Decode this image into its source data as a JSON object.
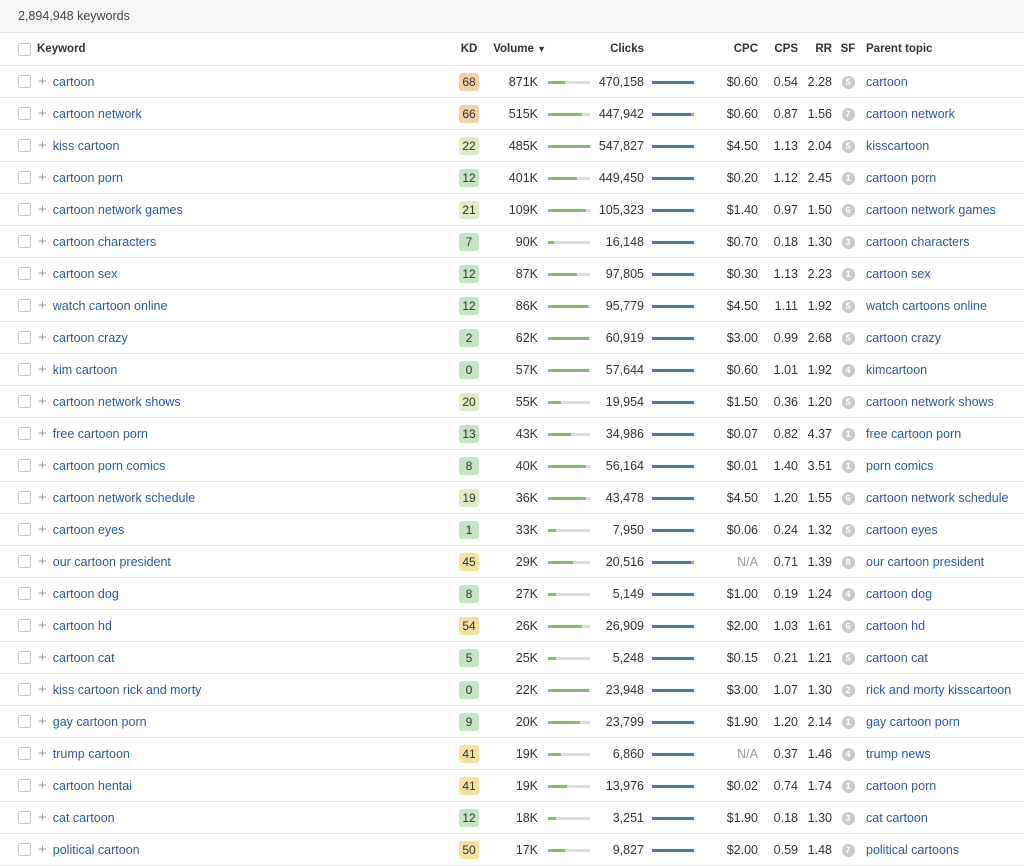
{
  "summary": "2,894,948 keywords",
  "headers": {
    "keyword": "Keyword",
    "kd": "KD",
    "volume": "Volume",
    "clicks": "Clicks",
    "cpc": "CPC",
    "cps": "CPS",
    "rr": "RR",
    "sf": "SF",
    "parent_topic": "Parent topic"
  },
  "sort_indicator": "▼",
  "colors": {
    "link": "#2b59a6",
    "volume_bar": "#7ac36a",
    "clicks_bar": "#4a79b9",
    "clicks_tip": "#e8a23a"
  },
  "rows": [
    {
      "keyword": "cartoon",
      "kd": "68",
      "kd_color": "#f2d2a6",
      "volume": "871K",
      "volume_level": 0.4,
      "clicks": "470,158",
      "tip": false,
      "cpc": "$0.60",
      "cps": "0.54",
      "rr": "2.28",
      "sf": "5",
      "parent": "cartoon"
    },
    {
      "keyword": "cartoon network",
      "kd": "66",
      "kd_color": "#f2d2a6",
      "volume": "515K",
      "volume_level": 0.8,
      "clicks": "447,942",
      "tip": true,
      "cpc": "$0.60",
      "cps": "0.87",
      "rr": "1.56",
      "sf": "7",
      "parent": "cartoon network"
    },
    {
      "keyword": "kiss cartoon",
      "kd": "22",
      "kd_color": "#e0eac4",
      "volume": "485K",
      "volume_level": 1.0,
      "clicks": "547,827",
      "tip": false,
      "cpc": "$4.50",
      "cps": "1.13",
      "rr": "2.04",
      "sf": "5",
      "parent": "kisscartoon"
    },
    {
      "keyword": "cartoon porn",
      "kd": "12",
      "kd_color": "#c7e2c5",
      "volume": "401K",
      "volume_level": 0.7,
      "clicks": "449,450",
      "tip": false,
      "cpc": "$0.20",
      "cps": "1.12",
      "rr": "2.45",
      "sf": "1",
      "parent": "cartoon porn"
    },
    {
      "keyword": "cartoon network games",
      "kd": "21",
      "kd_color": "#e0eac4",
      "volume": "109K",
      "volume_level": 0.9,
      "clicks": "105,323",
      "tip": false,
      "cpc": "$1.40",
      "cps": "0.97",
      "rr": "1.50",
      "sf": "6",
      "parent": "cartoon network games"
    },
    {
      "keyword": "cartoon characters",
      "kd": "7",
      "kd_color": "#c7e2c5",
      "volume": "90K",
      "volume_level": 0.15,
      "clicks": "16,148",
      "tip": false,
      "cpc": "$0.70",
      "cps": "0.18",
      "rr": "1.30",
      "sf": "3",
      "parent": "cartoon characters"
    },
    {
      "keyword": "cartoon sex",
      "kd": "12",
      "kd_color": "#c7e2c5",
      "volume": "87K",
      "volume_level": 0.7,
      "clicks": "97,805",
      "tip": false,
      "cpc": "$0.30",
      "cps": "1.13",
      "rr": "2.23",
      "sf": "1",
      "parent": "cartoon sex"
    },
    {
      "keyword": "watch cartoon online",
      "kd": "12",
      "kd_color": "#c7e2c5",
      "volume": "86K",
      "volume_level": 0.95,
      "clicks": "95,779",
      "tip": false,
      "cpc": "$4.50",
      "cps": "1.11",
      "rr": "1.92",
      "sf": "5",
      "parent": "watch cartoons online"
    },
    {
      "keyword": "cartoon crazy",
      "kd": "2",
      "kd_color": "#c7e2c5",
      "volume": "62K",
      "volume_level": 0.98,
      "clicks": "60,919",
      "tip": false,
      "cpc": "$3.00",
      "cps": "0.99",
      "rr": "2.68",
      "sf": "5",
      "parent": "cartoon crazy"
    },
    {
      "keyword": "kim cartoon",
      "kd": "0",
      "kd_color": "#c7e2c5",
      "volume": "57K",
      "volume_level": 0.98,
      "clicks": "57,644",
      "tip": false,
      "cpc": "$0.60",
      "cps": "1.01",
      "rr": "1.92",
      "sf": "4",
      "parent": "kimcartoon"
    },
    {
      "keyword": "cartoon network shows",
      "kd": "20",
      "kd_color": "#e0eac4",
      "volume": "55K",
      "volume_level": 0.3,
      "clicks": "19,954",
      "tip": false,
      "cpc": "$1.50",
      "cps": "0.36",
      "rr": "1.20",
      "sf": "5",
      "parent": "cartoon network shows"
    },
    {
      "keyword": "free cartoon porn",
      "kd": "13",
      "kd_color": "#c7e2c5",
      "volume": "43K",
      "volume_level": 0.55,
      "clicks": "34,986",
      "tip": false,
      "cpc": "$0.07",
      "cps": "0.82",
      "rr": "4.37",
      "sf": "1",
      "parent": "free cartoon porn"
    },
    {
      "keyword": "cartoon porn comics",
      "kd": "8",
      "kd_color": "#c7e2c5",
      "volume": "40K",
      "volume_level": 0.9,
      "clicks": "56,164",
      "tip": false,
      "cpc": "$0.01",
      "cps": "1.40",
      "rr": "3.51",
      "sf": "1",
      "parent": "porn comics"
    },
    {
      "keyword": "cartoon network schedule",
      "kd": "19",
      "kd_color": "#e0eac4",
      "volume": "36K",
      "volume_level": 0.9,
      "clicks": "43,478",
      "tip": false,
      "cpc": "$4.50",
      "cps": "1.20",
      "rr": "1.55",
      "sf": "6",
      "parent": "cartoon network schedule"
    },
    {
      "keyword": "cartoon eyes",
      "kd": "1",
      "kd_color": "#c7e2c5",
      "volume": "33K",
      "volume_level": 0.2,
      "clicks": "7,950",
      "tip": false,
      "cpc": "$0.06",
      "cps": "0.24",
      "rr": "1.32",
      "sf": "5",
      "parent": "cartoon eyes"
    },
    {
      "keyword": "our cartoon president",
      "kd": "45",
      "kd_color": "#f5e2a0",
      "volume": "29K",
      "volume_level": 0.6,
      "clicks": "20,516",
      "tip": true,
      "cpc": "N/A",
      "cps": "0.71",
      "rr": "1.39",
      "sf": "8",
      "parent": "our cartoon president"
    },
    {
      "keyword": "cartoon dog",
      "kd": "8",
      "kd_color": "#c7e2c5",
      "volume": "27K",
      "volume_level": 0.2,
      "clicks": "5,149",
      "tip": false,
      "cpc": "$1.00",
      "cps": "0.19",
      "rr": "1.24",
      "sf": "4",
      "parent": "cartoon dog"
    },
    {
      "keyword": "cartoon hd",
      "kd": "54",
      "kd_color": "#f5e2a0",
      "volume": "26K",
      "volume_level": 0.8,
      "clicks": "26,909",
      "tip": false,
      "cpc": "$2.00",
      "cps": "1.03",
      "rr": "1.61",
      "sf": "6",
      "parent": "cartoon hd"
    },
    {
      "keyword": "cartoon cat",
      "kd": "5",
      "kd_color": "#c7e2c5",
      "volume": "25K",
      "volume_level": 0.2,
      "clicks": "5,248",
      "tip": false,
      "cpc": "$0.15",
      "cps": "0.21",
      "rr": "1.21",
      "sf": "5",
      "parent": "cartoon cat"
    },
    {
      "keyword": "kiss cartoon rick and morty",
      "kd": "0",
      "kd_color": "#c7e2c5",
      "volume": "22K",
      "volume_level": 0.98,
      "clicks": "23,948",
      "tip": false,
      "cpc": "$3.00",
      "cps": "1.07",
      "rr": "1.30",
      "sf": "2",
      "parent": "rick and morty kisscartoon"
    },
    {
      "keyword": "gay cartoon porn",
      "kd": "9",
      "kd_color": "#c7e2c5",
      "volume": "20K",
      "volume_level": 0.75,
      "clicks": "23,799",
      "tip": false,
      "cpc": "$1.90",
      "cps": "1.20",
      "rr": "2.14",
      "sf": "1",
      "parent": "gay cartoon porn"
    },
    {
      "keyword": "trump cartoon",
      "kd": "41",
      "kd_color": "#f5e2a0",
      "volume": "19K",
      "volume_level": 0.3,
      "clicks": "6,860",
      "tip": false,
      "cpc": "N/A",
      "cps": "0.37",
      "rr": "1.46",
      "sf": "4",
      "parent": "trump news"
    },
    {
      "keyword": "cartoon hentai",
      "kd": "41",
      "kd_color": "#f5e2a0",
      "volume": "19K",
      "volume_level": 0.45,
      "clicks": "13,976",
      "tip": false,
      "cpc": "$0.02",
      "cps": "0.74",
      "rr": "1.74",
      "sf": "1",
      "parent": "cartoon porn"
    },
    {
      "keyword": "cat cartoon",
      "kd": "12",
      "kd_color": "#c7e2c5",
      "volume": "18K",
      "volume_level": 0.18,
      "clicks": "3,251",
      "tip": false,
      "cpc": "$1.90",
      "cps": "0.18",
      "rr": "1.30",
      "sf": "3",
      "parent": "cat cartoon"
    },
    {
      "keyword": "political cartoon",
      "kd": "50",
      "kd_color": "#f5e2a0",
      "volume": "17K",
      "volume_level": 0.4,
      "clicks": "9,827",
      "tip": false,
      "cpc": "$2.00",
      "cps": "0.59",
      "rr": "1.48",
      "sf": "7",
      "parent": "political cartoons"
    }
  ]
}
